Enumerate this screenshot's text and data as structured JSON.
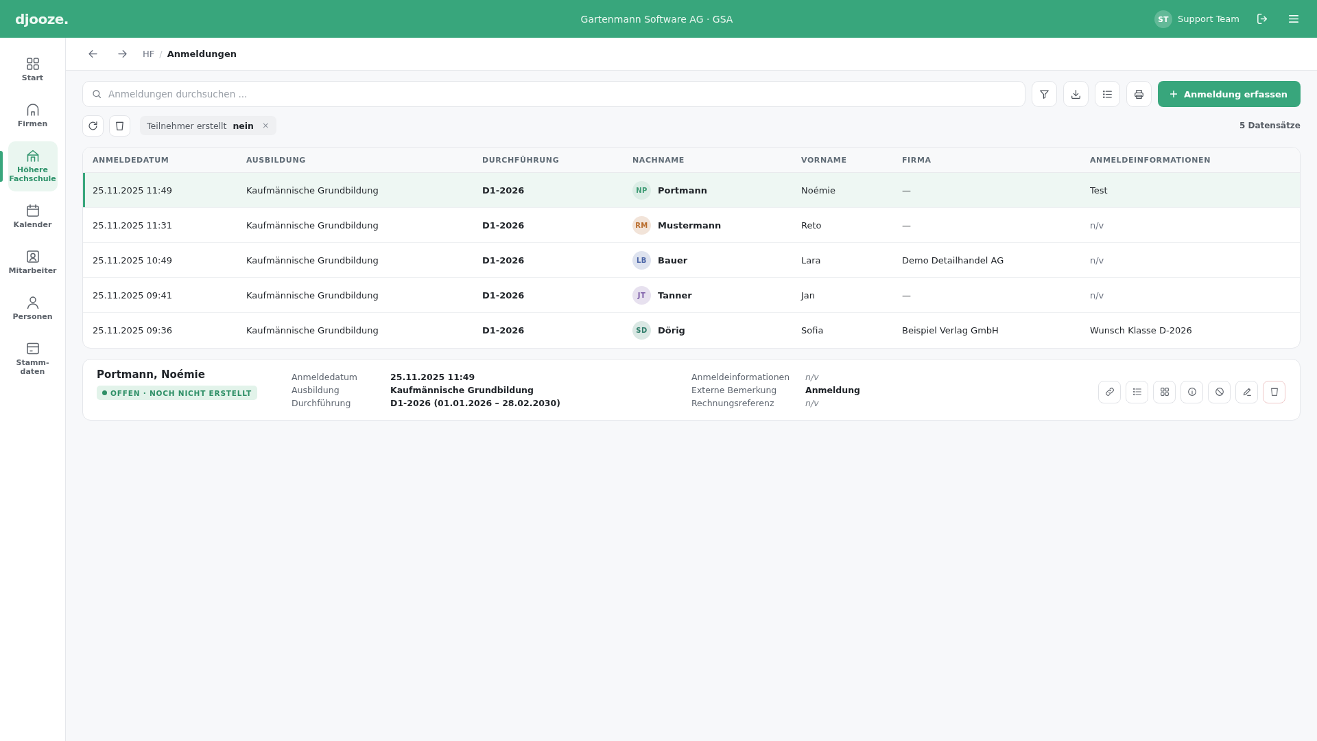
{
  "top_bar": {
    "logo": "djooze.",
    "title": "Gartenmann Software AG · GSA",
    "user": {
      "initials": "ST",
      "name": "Support Team"
    }
  },
  "sidebar": {
    "items": [
      {
        "label": "Start",
        "selected": false
      },
      {
        "label": "Firmen",
        "selected": false
      },
      {
        "label": "Höhere Fachschule",
        "selected": true
      },
      {
        "label": "Kalender",
        "selected": false
      },
      {
        "label": "Mitarbeiter",
        "selected": false
      },
      {
        "label": "Personen",
        "selected": false
      },
      {
        "label": "Stamm-daten",
        "selected": false
      }
    ]
  },
  "breadcrumb": {
    "items": [
      {
        "label": "HF",
        "current": false
      },
      {
        "label": "Anmeldungen",
        "current": true
      }
    ],
    "separator": "/"
  },
  "search": {
    "placeholder": "Anmeldungen durchsuchen ..."
  },
  "primary_button": {
    "label": "Anmeldung erfassen"
  },
  "filters": [
    {
      "label": "Teilnehmer erstellt",
      "value": "nein",
      "remove": "×"
    }
  ],
  "record_count": "5 Datensätze",
  "table": {
    "columns": [
      "ANMELDEDATUM",
      "AUSBILDUNG",
      "DURCHFÜHRUNG",
      "NACHNAME",
      "VORNAME",
      "FIRMA",
      "ANMELDEINFORMATIONEN"
    ],
    "rows": [
      {
        "selected": true,
        "date": "25.11.2025 11:49",
        "course": "Kaufmännische Grundbildung",
        "run": "D1-2026",
        "initials": "NP",
        "color": "#3c9a73",
        "last_name": "Portmann",
        "first_name": "Noémie",
        "company": "—",
        "info": "Test",
        "info_missing": false
      },
      {
        "selected": false,
        "date": "25.11.2025 11:31",
        "course": "Kaufmännische Grundbildung",
        "run": "D1-2026",
        "initials": "RM",
        "color": "#b86b2a",
        "last_name": "Mustermann",
        "first_name": "Reto",
        "company": "—",
        "info": "n/v",
        "info_missing": true
      },
      {
        "selected": false,
        "date": "25.11.2025 10:49",
        "course": "Kaufmännische Grundbildung",
        "run": "D1-2026",
        "initials": "LB",
        "color": "#4a64a6",
        "last_name": "Bauer",
        "first_name": "Lara",
        "company": "Demo Detailhandel AG",
        "info": "n/v",
        "info_missing": true
      },
      {
        "selected": false,
        "date": "25.11.2025 09:41",
        "course": "Kaufmännische Grundbildung",
        "run": "D1-2026",
        "initials": "JT",
        "color": "#7b5ba6",
        "last_name": "Tanner",
        "first_name": "Jan",
        "company": "—",
        "info": "n/v",
        "info_missing": true
      },
      {
        "selected": false,
        "date": "25.11.2025 09:36",
        "course": "Kaufmännische Grundbildung",
        "run": "D1-2026",
        "initials": "SD",
        "color": "#2f7d6a",
        "last_name": "Dörig",
        "first_name": "Sofia",
        "company": "Beispiel Verlag GmbH",
        "info": "Wunsch Klasse D-2026",
        "info_missing": false
      }
    ]
  },
  "detail": {
    "title": "Portmann, Noémie",
    "status": "OFFEN · NOCH NICHT ERSTELLT",
    "field_groups": [
      {
        "fields": [
          {
            "label": "Anmeldedatum",
            "value": "25.11.2025 11:49",
            "missing": false
          },
          {
            "label": "Ausbildung",
            "value": "Kaufmännische Grundbildung",
            "missing": false
          },
          {
            "label": "Durchführung",
            "value": "D1-2026 (01.01.2026 – 28.02.2030)",
            "missing": false
          }
        ]
      },
      {
        "fields": [
          {
            "label": "Anmeldeinformationen",
            "value": "n/v",
            "missing": true
          },
          {
            "label": "Externe Bemerkung",
            "value": "Anmeldung",
            "missing": false
          },
          {
            "label": "Rechnungsreferenz",
            "value": "n/v",
            "missing": true
          }
        ]
      }
    ]
  }
}
